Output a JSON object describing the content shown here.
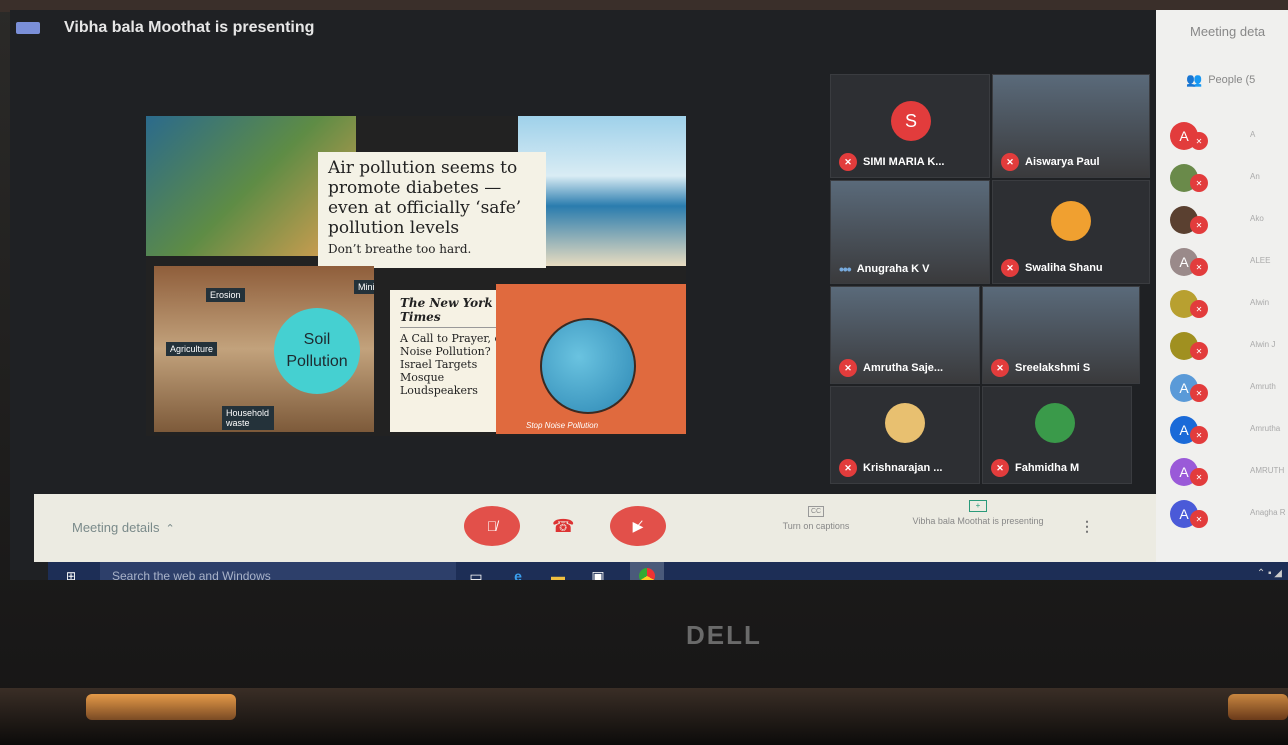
{
  "topbar": {
    "presenting_text": "Vibha bala Moothat is presenting"
  },
  "slide": {
    "headline": "Air pollution seems to promote diabetes — even at officially ‘safe’ pollution levels",
    "subhead": "Don’t breathe too hard.",
    "soil_circle": "Soil Pollution",
    "tags": {
      "erosion": "Erosion",
      "mining": "Mining",
      "agriculture": "Agriculture",
      "household": "Household waste"
    },
    "nyt_masthead": "The New York Times",
    "nyt_body": "A Call to Prayer, or Noise Pollution? Israel Targets Mosque Loudspeakers",
    "noise_caption": "Stop Noise Pollution"
  },
  "participants": [
    {
      "name": "SIMI MARIA K...",
      "initial": "S",
      "muted": true
    },
    {
      "name": "Aiswarya Paul",
      "muted": true
    },
    {
      "name": "Anugraha K V",
      "muted": false
    },
    {
      "name": "Swaliha Shanu",
      "muted": true
    },
    {
      "name": "Amrutha Saje...",
      "muted": true
    },
    {
      "name": "Sreelakshmi S",
      "muted": true
    },
    {
      "name": "Krishnarajan ...",
      "muted": true
    },
    {
      "name": "Fahmidha M",
      "muted": true
    }
  ],
  "panel": {
    "title": "Meeting deta",
    "people_tab": "People (5",
    "rows": [
      {
        "initial": "A",
        "color": "#e23c3c",
        "name": "A"
      },
      {
        "initial": "",
        "color": "#6a8a4a",
        "name": "An"
      },
      {
        "initial": "",
        "color": "#5a4030",
        "name": "Ako"
      },
      {
        "initial": "A",
        "color": "#9a8a8a",
        "name": "ALEE"
      },
      {
        "initial": "",
        "color": "#b8a030",
        "name": "Alwin"
      },
      {
        "initial": "",
        "color": "#a09020",
        "name": "Alwin J"
      },
      {
        "initial": "A",
        "color": "#5a9ad8",
        "name": "Amruth"
      },
      {
        "initial": "A",
        "color": "#1a6ad8",
        "name": "Amrutha"
      },
      {
        "initial": "A",
        "color": "#9a5ad8",
        "name": "AMRUTH"
      },
      {
        "initial": "A",
        "color": "#4a5ad8",
        "name": "Anagha R"
      }
    ]
  },
  "bottombar": {
    "meeting_details": "Meeting details",
    "captions": "Turn on captions",
    "presenting": "Vibha bala Moothat is presenting"
  },
  "taskbar": {
    "search_placeholder": "Search the web and Windows"
  },
  "brand": "DELL",
  "colors": {
    "mute_red": "#e23c3c",
    "taskbar": "#1d2e56",
    "panel_bg": "#f0f0ee"
  }
}
